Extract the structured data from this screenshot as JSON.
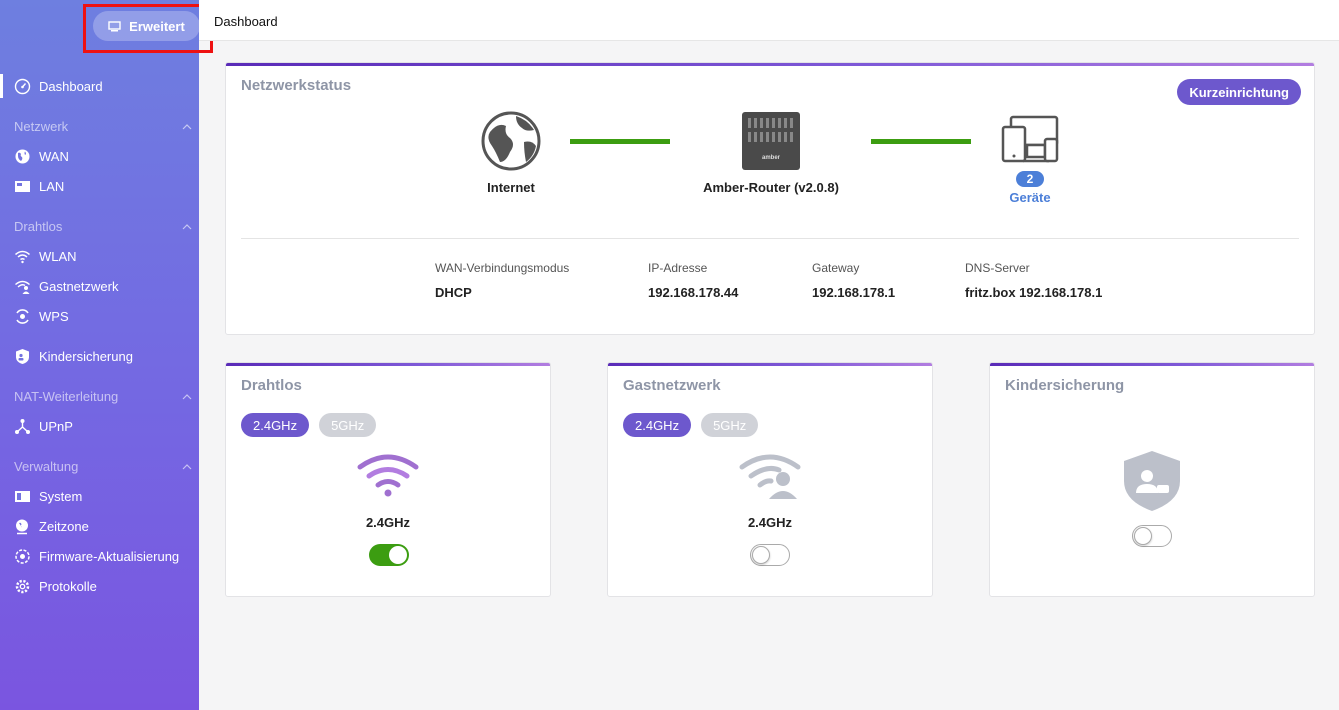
{
  "sidebar": {
    "mode_button": "Erweitert",
    "items": {
      "dashboard": "Dashboard",
      "wan": "WAN",
      "lan": "LAN",
      "wlan": "WLAN",
      "guest": "Gastnetzwerk",
      "wps": "WPS",
      "parental": "Kindersicherung",
      "upnp": "UPnP",
      "system": "System",
      "timezone": "Zeitzone",
      "firmware": "Firmware-Aktualisierung",
      "logs": "Protokolle"
    },
    "sections": {
      "network": "Netzwerk",
      "wireless": "Drahtlos",
      "nat": "NAT-Weiterleitung",
      "admin": "Verwaltung"
    }
  },
  "topbar": {
    "breadcrumb": "Dashboard"
  },
  "network_status": {
    "title": "Netzwerkstatus",
    "quick_setup": "Kurzeinrichtung",
    "internet_label": "Internet",
    "router_label": "Amber-Router (v2.0.8)",
    "device_count": "2",
    "devices_label": "Geräte",
    "router_brand": "amber",
    "info": {
      "mode_label": "WAN-Verbindungsmodus",
      "mode_value": "DHCP",
      "ip_label": "IP-Adresse",
      "ip_value": "192.168.178.44",
      "gateway_label": "Gateway",
      "gateway_value": "192.168.178.1",
      "dns_label": "DNS-Server",
      "dns_value": "fritz.box 192.168.178.1"
    }
  },
  "wireless_card": {
    "title": "Drahtlos",
    "band_24": "2.4GHz",
    "band_5": "5GHz",
    "label": "2.4GHz",
    "enabled": true
  },
  "guest_card": {
    "title": "Gastnetzwerk",
    "band_24": "2.4GHz",
    "band_5": "5GHz",
    "label": "2.4GHz",
    "enabled": false
  },
  "parental_card": {
    "title": "Kindersicherung",
    "enabled": false
  },
  "colors": {
    "accent": "#6d58cd",
    "link_ok": "#3c9d11",
    "badge": "#4c7fd8"
  }
}
